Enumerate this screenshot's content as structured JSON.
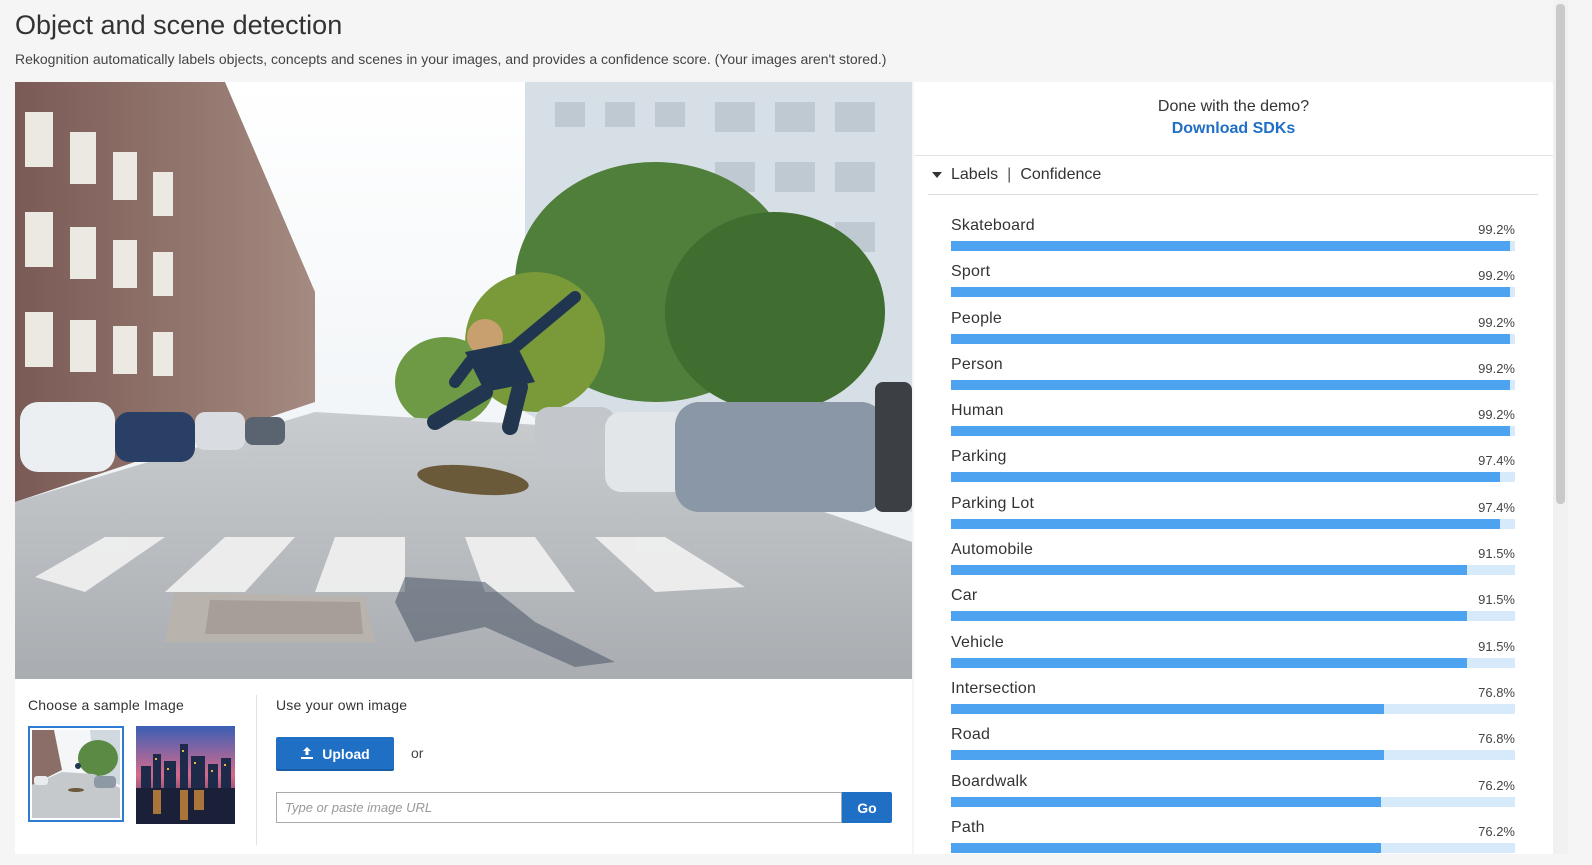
{
  "header": {
    "title": "Object and scene detection",
    "subtitle": "Rekognition automatically labels objects, concepts and scenes in your images, and provides a confidence score. (Your images aren't stored.)"
  },
  "samples": {
    "label": "Choose a sample Image"
  },
  "own_image": {
    "label": "Use your own image",
    "upload_label": "Upload",
    "or_text": "or",
    "url_placeholder": "Type or paste image URL",
    "go_label": "Go"
  },
  "demo": {
    "question": "Done with the demo?",
    "link_label": "Download SDKs"
  },
  "labels_header": {
    "labels": "Labels",
    "separator": "|",
    "confidence": "Confidence"
  },
  "colors": {
    "accent": "#1f6fc5",
    "bar_fill": "#4da3f0",
    "bar_track": "#d6eafb"
  },
  "labels": [
    {
      "name": "Skateboard",
      "confidence_text": "99.2%",
      "confidence": 99.2
    },
    {
      "name": "Sport",
      "confidence_text": "99.2%",
      "confidence": 99.2
    },
    {
      "name": "People",
      "confidence_text": "99.2%",
      "confidence": 99.2
    },
    {
      "name": "Person",
      "confidence_text": "99.2%",
      "confidence": 99.2
    },
    {
      "name": "Human",
      "confidence_text": "99.2%",
      "confidence": 99.2
    },
    {
      "name": "Parking",
      "confidence_text": "97.4%",
      "confidence": 97.4
    },
    {
      "name": "Parking Lot",
      "confidence_text": "97.4%",
      "confidence": 97.4
    },
    {
      "name": "Automobile",
      "confidence_text": "91.5%",
      "confidence": 91.5
    },
    {
      "name": "Car",
      "confidence_text": "91.5%",
      "confidence": 91.5
    },
    {
      "name": "Vehicle",
      "confidence_text": "91.5%",
      "confidence": 91.5
    },
    {
      "name": "Intersection",
      "confidence_text": "76.8%",
      "confidence": 76.8
    },
    {
      "name": "Road",
      "confidence_text": "76.8%",
      "confidence": 76.8
    },
    {
      "name": "Boardwalk",
      "confidence_text": "76.2%",
      "confidence": 76.2
    },
    {
      "name": "Path",
      "confidence_text": "76.2%",
      "confidence": 76.2
    }
  ]
}
